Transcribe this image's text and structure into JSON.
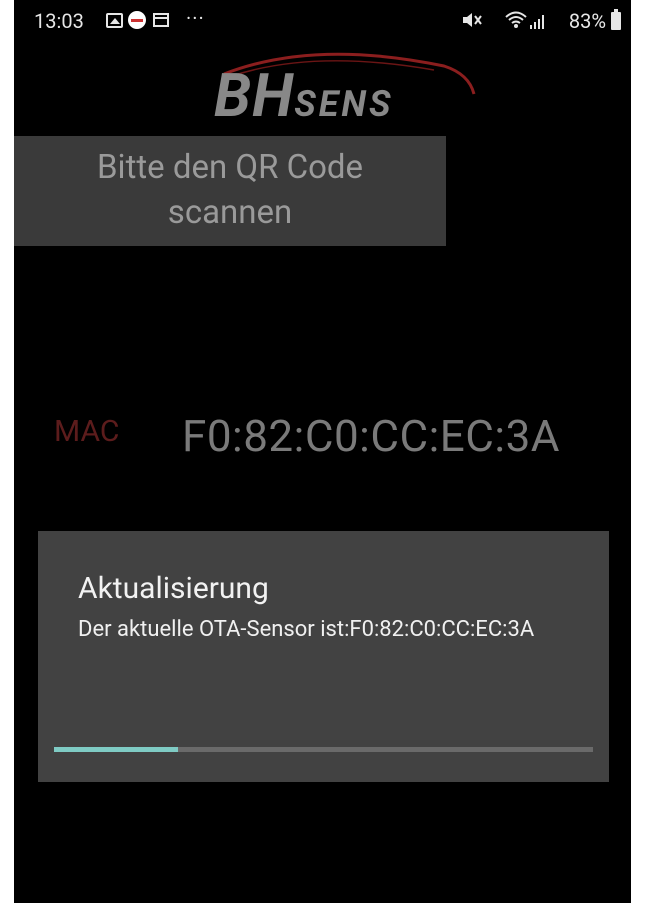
{
  "status_bar": {
    "time": "13:03",
    "more": "···",
    "battery": "83%",
    "icons": [
      "gallery-icon",
      "app-notification-icon",
      "calendar-icon",
      "more-icon",
      "mute-icon",
      "wifi-icon",
      "signal-icon",
      "battery-icon"
    ]
  },
  "logo": {
    "text_main": "BH",
    "text_sub": "SENS",
    "color_text": "#888888",
    "color_swoosh": "#8b1e1e"
  },
  "qr_prompt": {
    "text": "Bitte den QR Code scannen"
  },
  "mac": {
    "label": "MAC",
    "value": "F0:82:C0:CC:EC:3A",
    "label_color": "#5c1c1c"
  },
  "dialog": {
    "title": "Aktualisierung",
    "message": "Der aktuelle OTA-Sensor ist:F0:82:C0:CC:EC:3A",
    "progress": 0.23,
    "progress_color": "#7fcbc4"
  }
}
